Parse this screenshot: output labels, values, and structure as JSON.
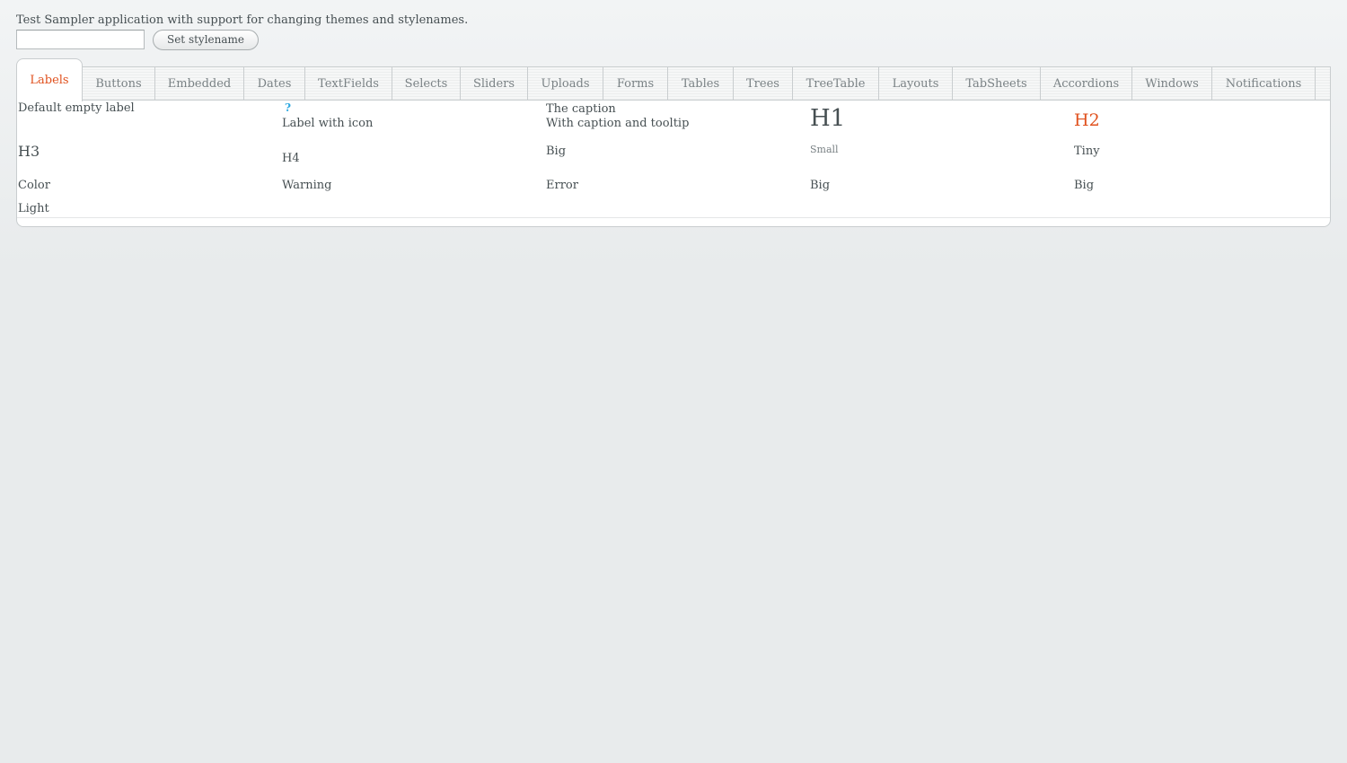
{
  "intro_text": "Test Sampler application with support for changing themes and stylenames.",
  "stylename_input": {
    "value": "",
    "placeholder": ""
  },
  "set_stylename_label": "Set stylename",
  "tabs": [
    {
      "label": "Labels",
      "selected": true
    },
    {
      "label": "Buttons",
      "selected": false
    },
    {
      "label": "Embedded",
      "selected": false
    },
    {
      "label": "Dates",
      "selected": false
    },
    {
      "label": "TextFields",
      "selected": false
    },
    {
      "label": "Selects",
      "selected": false
    },
    {
      "label": "Sliders",
      "selected": false
    },
    {
      "label": "Uploads",
      "selected": false
    },
    {
      "label": "Forms",
      "selected": false
    },
    {
      "label": "Tables",
      "selected": false
    },
    {
      "label": "Trees",
      "selected": false
    },
    {
      "label": "TreeTable",
      "selected": false
    },
    {
      "label": "Layouts",
      "selected": false
    },
    {
      "label": "TabSheets",
      "selected": false
    },
    {
      "label": "Accordions",
      "selected": false
    },
    {
      "label": "Windows",
      "selected": false
    },
    {
      "label": "Notifications",
      "selected": false
    }
  ],
  "labels": {
    "default_empty": "Default empty label",
    "icon_glyph": "?",
    "with_icon": "Label with icon",
    "caption": "The caption",
    "caption_tooltip": "With caption and tooltip",
    "h1": "H1",
    "h2": "H2",
    "h3": "H3",
    "h4": "H4",
    "big": "Big",
    "small": "Small",
    "tiny": "Tiny",
    "color": "Color",
    "warning": "Warning",
    "error": "Error",
    "big_2": "Big",
    "big_3": "Big",
    "light": "Light"
  },
  "colors": {
    "accent": "#e0511e",
    "text": "#464f52",
    "icon": "#2aa7e0"
  }
}
